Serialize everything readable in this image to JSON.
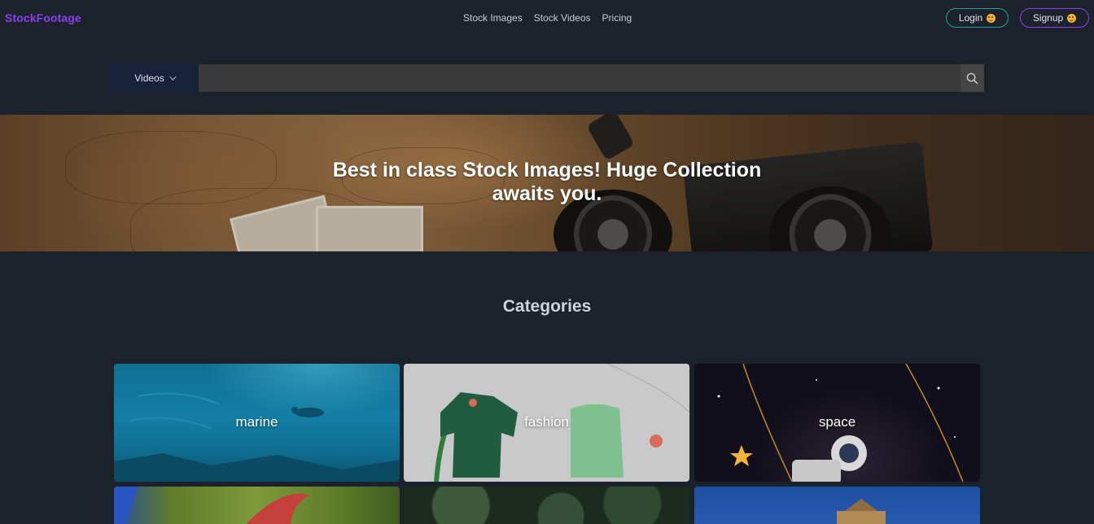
{
  "nav": {
    "brand": "StockFootage",
    "links": [
      "Stock Images",
      "Stock Videos",
      "Pricing"
    ],
    "login_label": "Login",
    "signup_label": "Signup"
  },
  "search": {
    "type_label": "Videos",
    "placeholder": "",
    "value": ""
  },
  "hero": {
    "title_line1": "Best in class Stock Images! Huge Collection",
    "title_line2": "awaits you."
  },
  "categories": {
    "heading": "Categories",
    "items": [
      {
        "label": "marine"
      },
      {
        "label": "fashion"
      },
      {
        "label": "space"
      },
      {
        "label": ""
      },
      {
        "label": ""
      },
      {
        "label": ""
      }
    ]
  },
  "colors": {
    "background": "#1c222c",
    "brand": "#8a3ff0",
    "login_border": "#1fa58d",
    "signup_border": "#8a3ff0",
    "search_type_bg": "#17213a"
  },
  "icons": {
    "login_emoji": "smiley-face-icon",
    "signup_emoji": "smiley-face-icon",
    "dropdown": "chevron-down-icon",
    "search": "search-icon"
  }
}
